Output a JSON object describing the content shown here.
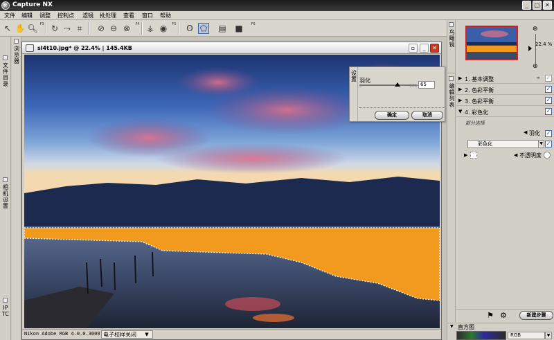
{
  "app": {
    "title": "Capture NX"
  },
  "menu": [
    "文件",
    "编辑",
    "调整",
    "控制点",
    "滤镜",
    "批处理",
    "查看",
    "窗口",
    "帮助"
  ],
  "toolbar": {
    "fkeys": [
      "F3",
      "F4",
      "F5",
      "F6"
    ]
  },
  "left_dock": {
    "tabs": [
      "浏览器",
      "文件目录",
      "相机设置",
      "IPTC"
    ]
  },
  "document": {
    "title": "sl4t10.jpg* @ 22.4% | 145.4KB",
    "status_profile": "Nikon Adobe RGB 4.0.0.3000",
    "status_softproof": "电子校样关闭"
  },
  "dialog": {
    "side_label": "设置",
    "field_label": "羽化",
    "slider_min": "0",
    "slider_max": "100",
    "value": "65",
    "slider_fraction": 0.65,
    "ok": "确定",
    "cancel": "取消"
  },
  "right_panel": {
    "birdseye_tab": "鸟瞰镜",
    "zoom": "22.4 %",
    "edit_tab": "编辑列表",
    "steps": [
      {
        "label": "1. 基本调整",
        "checked": true
      },
      {
        "label": "2. 色彩平衡",
        "checked": true
      },
      {
        "label": "3. 色彩平衡",
        "checked": true
      },
      {
        "label": "4. 彩色化",
        "checked": true
      }
    ],
    "sub_label": "部分选择",
    "feather_label": "羽化",
    "colorize_option": "彩色化",
    "opacity_label": "不透明度",
    "new_step": "新建步骤",
    "histogram_label": "直方图",
    "histogram_channel": "RGB"
  }
}
